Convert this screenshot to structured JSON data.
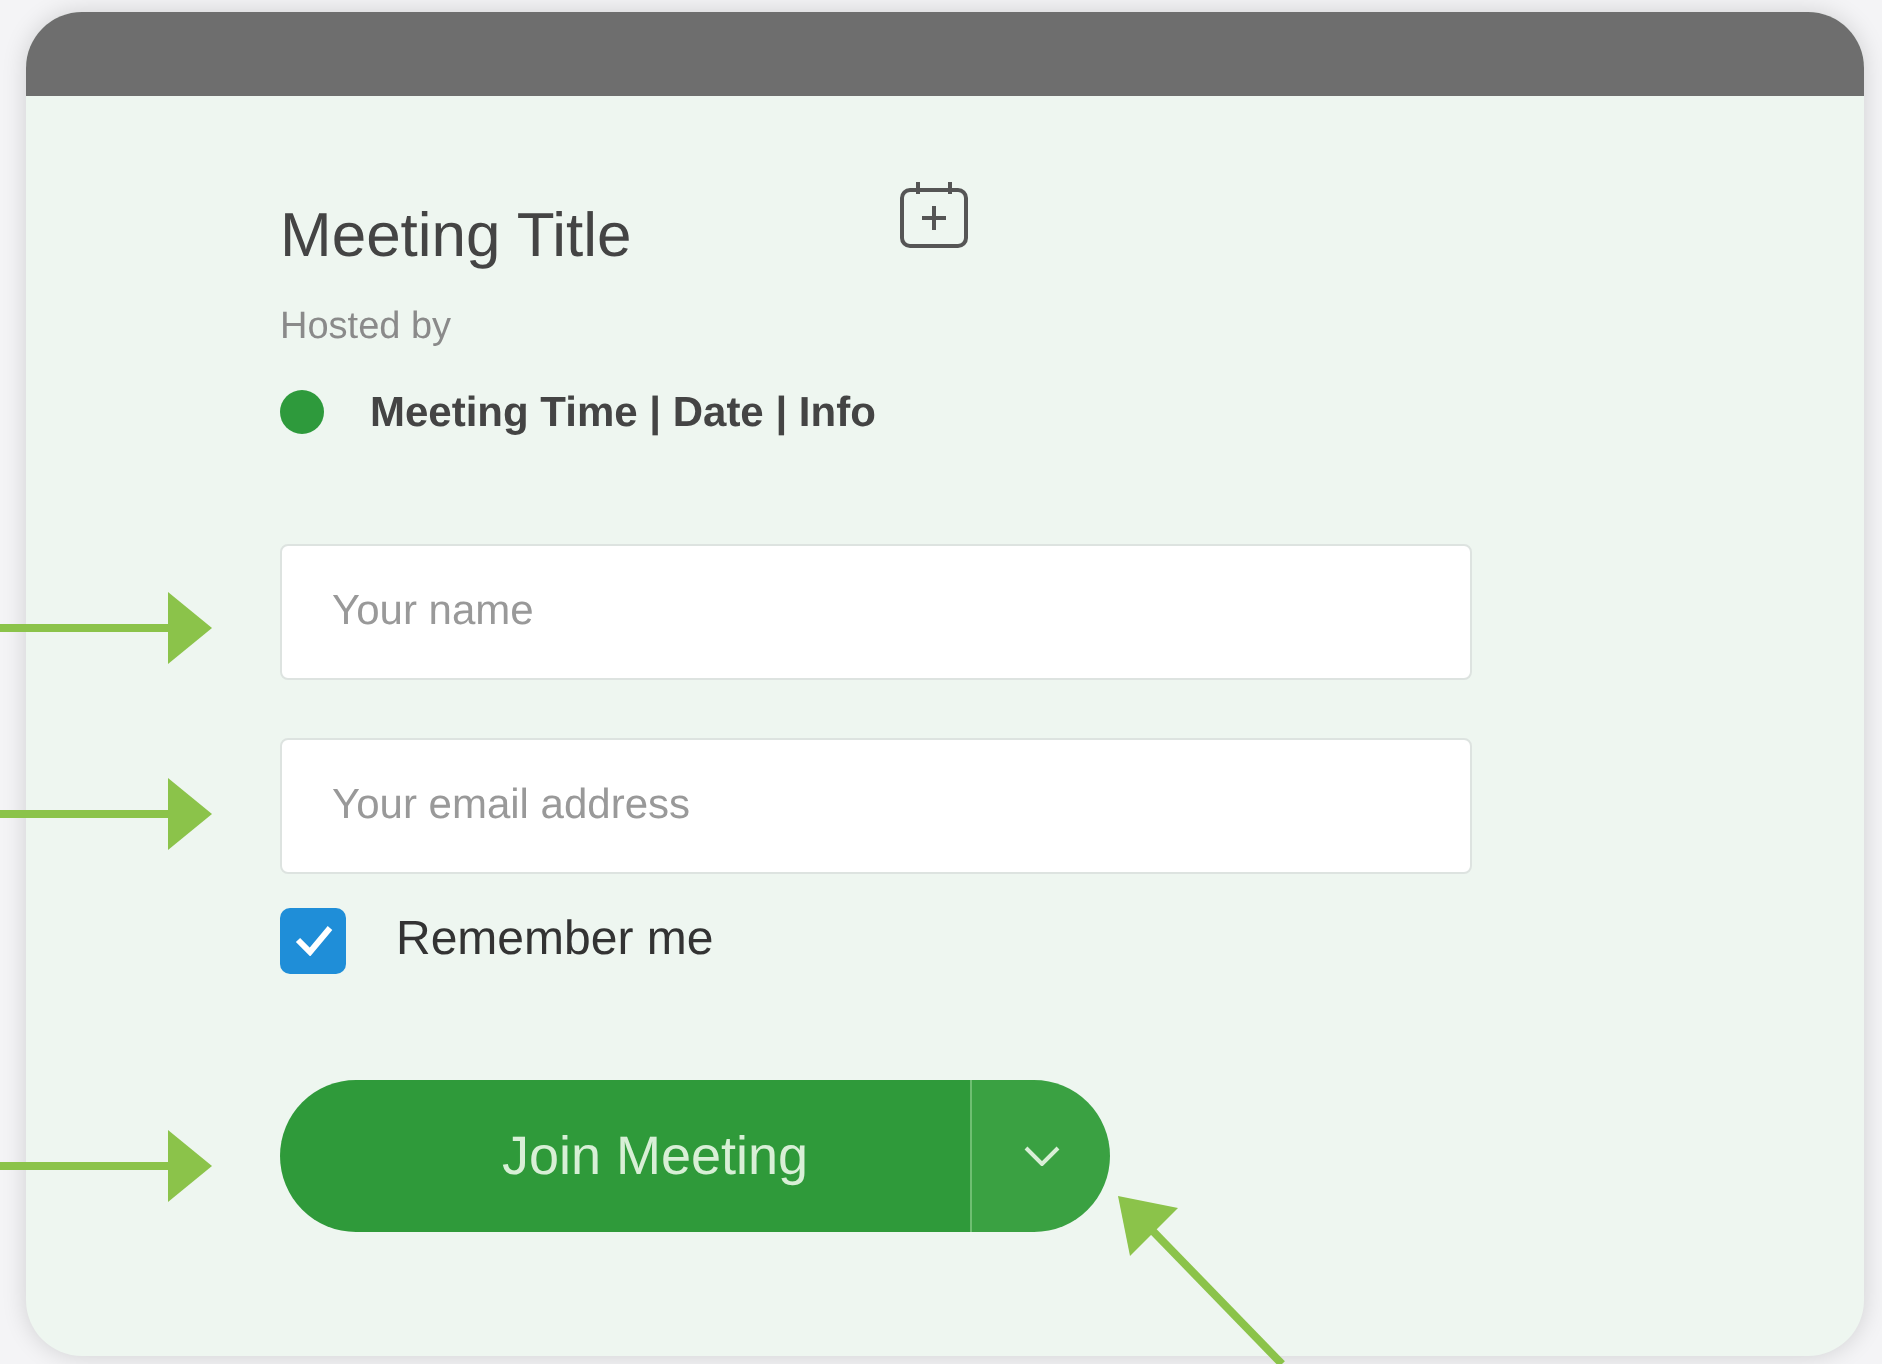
{
  "meeting": {
    "title": "Meeting Title",
    "hosted_by": "Hosted by",
    "info": "Meeting Time | Date | Info",
    "status": {
      "color": "#2e9a3c"
    }
  },
  "form": {
    "name_field": {
      "placeholder": "Your name"
    },
    "email_field": {
      "placeholder": "Your email address"
    },
    "remember_me": {
      "label": "Remember me",
      "checked": true
    },
    "join_button": {
      "label": "Join Meeting"
    }
  }
}
